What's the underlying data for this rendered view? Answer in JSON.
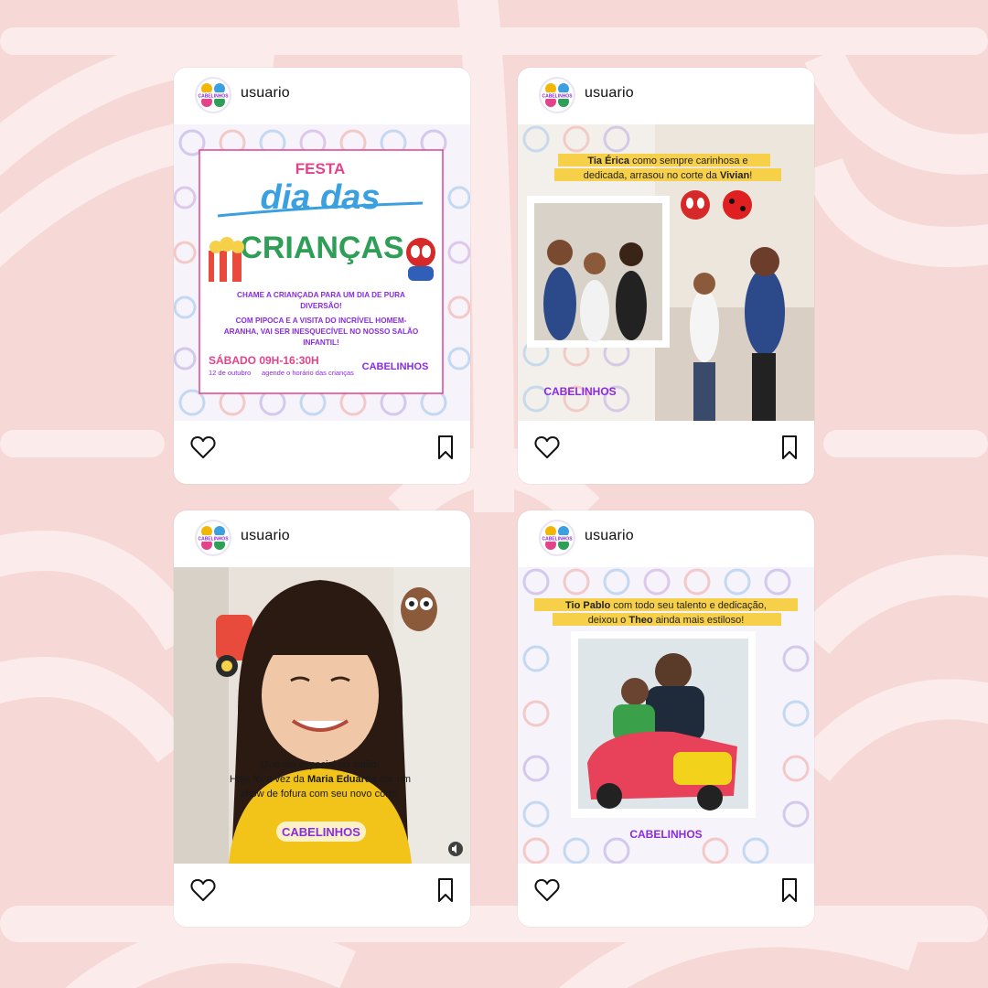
{
  "colors": {
    "background": "#f6d9d7",
    "pattern": "#fbe9e7",
    "card": "#ffffff",
    "accent_yellow": "#f7d04a",
    "brand_purple": "#8a2be2",
    "brand_pink": "#e2438a"
  },
  "posts": [
    {
      "username": "usuario",
      "avatar_icon": "cabelinhos-logo-avatar",
      "flyer": {
        "festa": "FESTA",
        "dia_das": "dia das",
        "criancas": "CRIANÇAS",
        "line1": "CHAME A CRIANÇADA PARA UM DIA DE PURA",
        "line2": "DIVERSÃO!",
        "line3": "COM PIPOCA E A VISITA DO INCRÍVEL HOMEM-",
        "line4": "ARANHA, VAI SER INESQUECÍVEL NO NOSSO SALÃO",
        "line5": "INFANTIL!",
        "schedule": "SÁBADO 09H-16:30H",
        "date": "12 de outubro",
        "booking": "agende o horário das crianças",
        "brand": "CABELINHOS"
      }
    },
    {
      "username": "usuario",
      "avatar_icon": "cabelinhos-logo-avatar",
      "caption_line1_bold": "Tia Érica",
      "caption_line1_rest": " como sempre carinhosa e",
      "caption_line2_rest": "dedicada, arrasou no corte da ",
      "caption_line2_bold": "Vivian",
      "caption_line2_end": "!",
      "brand": "CABELINHOS"
    },
    {
      "username": "usuario",
      "avatar_icon": "cabelinhos-logo-avatar",
      "caption_line1": "Que dia especial no salão!",
      "caption_line2_start": "Hoje foi a vez da ",
      "caption_line2_bold": "Maria Eduarda",
      "caption_line2_end": " dar um",
      "caption_line3": "show de fofura com seu novo corte.",
      "brand": "CABELINHOS"
    },
    {
      "username": "usuario",
      "avatar_icon": "cabelinhos-logo-avatar",
      "caption_line1_bold": "Tio Pablo",
      "caption_line1_rest": " com todo seu talento e dedicação,",
      "caption_line2_start": "deixou o ",
      "caption_line2_bold": "Theo",
      "caption_line2_end": " ainda mais estiloso!",
      "brand": "CABELINHOS"
    }
  ]
}
